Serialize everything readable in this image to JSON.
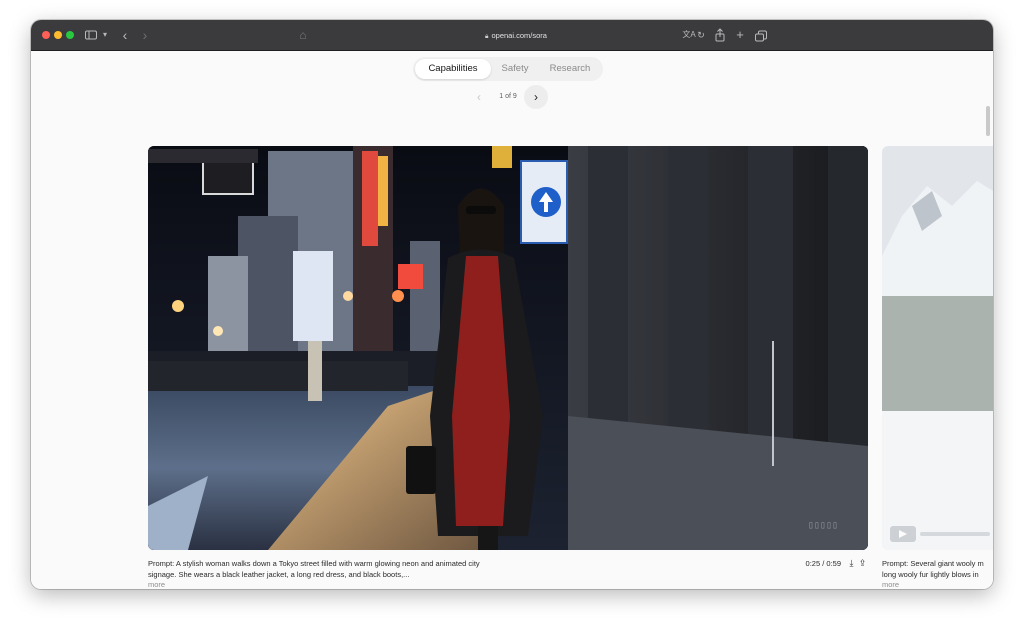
{
  "browser": {
    "url": "openai.com/sora",
    "icons": [
      "sidebar-icon",
      "chevron-down-icon",
      "back-icon",
      "forward-icon",
      "home-icon",
      "lock-icon",
      "translate-icon",
      "reload-icon",
      "share-icon",
      "new-tab-icon",
      "tab-overview-icon"
    ]
  },
  "tabs": [
    {
      "label": "Capabilities",
      "selected": true
    },
    {
      "label": "Safety",
      "selected": false
    },
    {
      "label": "Research",
      "selected": false
    }
  ],
  "pager": {
    "text": "1 of 9"
  },
  "main_video": {
    "caption": "Prompt: A stylish woman walks down a Tokyo street filled with warm glowing neon and animated city signage. She wears a black leather jacket, a long red dress, and black boots,...",
    "more": "more",
    "time": "0:25 / 0:59",
    "icons": [
      "download-icon",
      "share-icon"
    ]
  },
  "next_video": {
    "caption_line1": "Prompt: Several giant wooly m",
    "caption_line2": "long wooly fur lightly blows in",
    "more": "more"
  },
  "colors": {
    "titlebar": "#3b3b3d",
    "page_bg": "#fafafa",
    "segment_bg": "#f0f0f0",
    "accent_red_dress": "#8e1f1c"
  }
}
